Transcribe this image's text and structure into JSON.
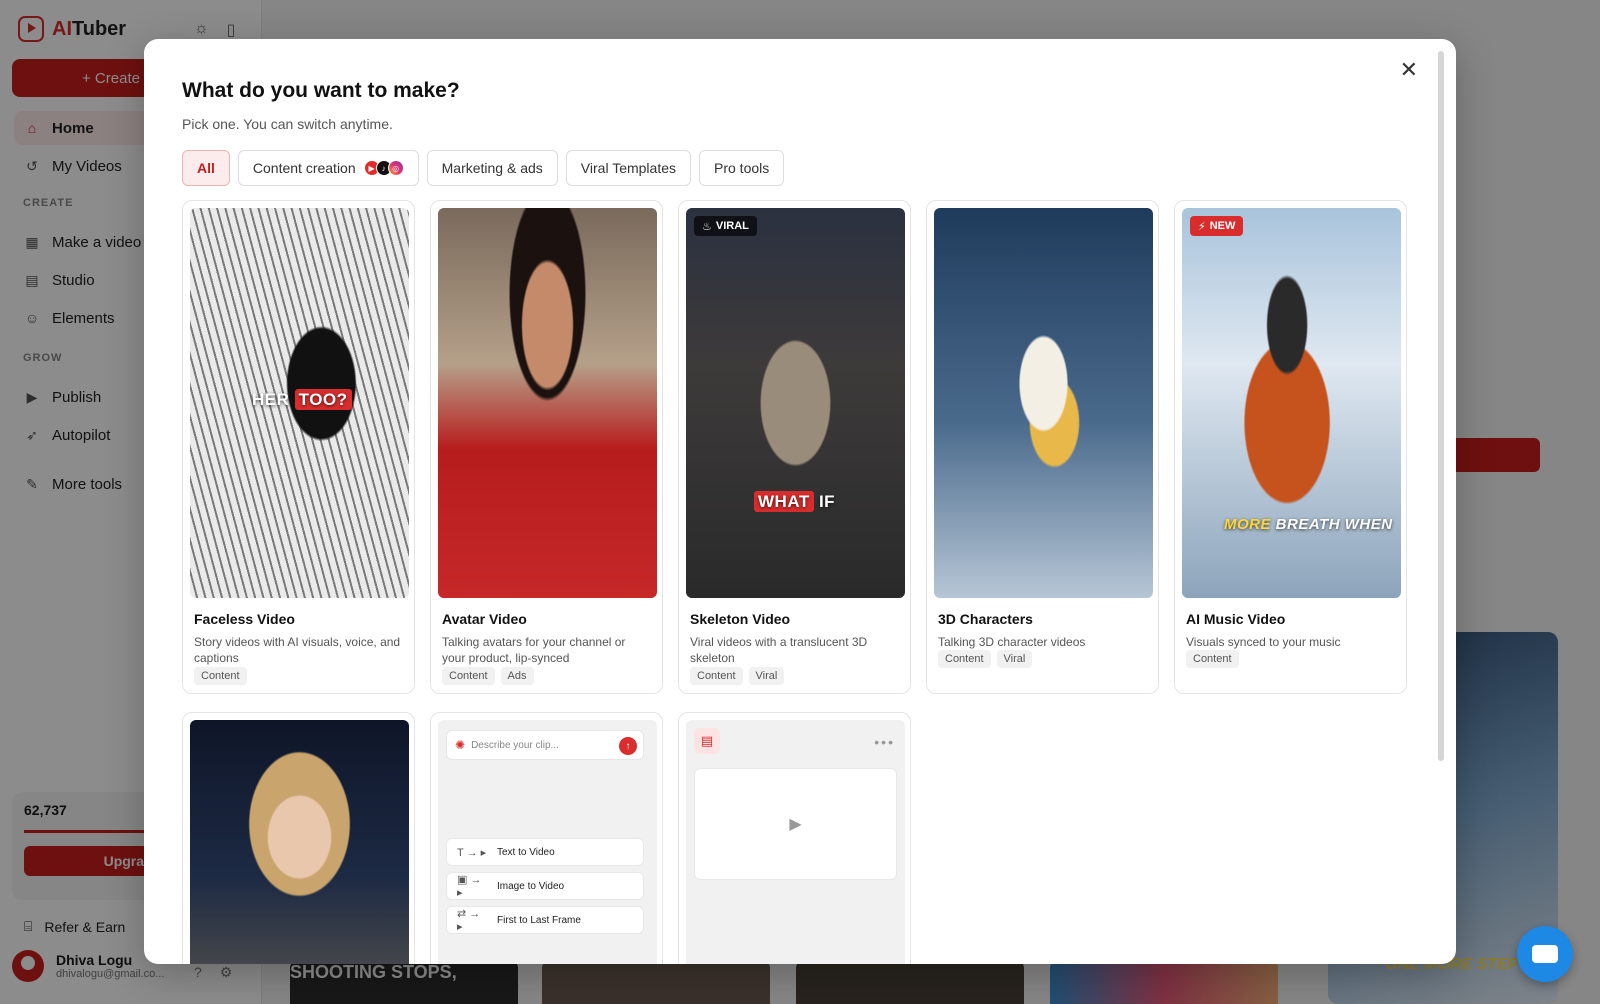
{
  "app": {
    "brand_prefix": "AI",
    "brand_suffix": "Tuber",
    "create_label": "+ Create",
    "nav": {
      "home": "Home",
      "my_videos": "My Videos",
      "section_create": "CREATE",
      "make_video": "Make a video",
      "studio": "Studio",
      "elements": "Elements",
      "section_grow": "GROW",
      "publish": "Publish",
      "autopilot": "Autopilot",
      "more_tools": "More tools"
    },
    "credits": "62,737",
    "upgrade_label": "Upgrade",
    "refer_label": "Refer & Earn",
    "user_name": "Dhiva Logu",
    "user_email": "dhivalogu@gmail.co...",
    "bg_caption_left": "SHOOTING STOPS,",
    "bg_caption_right": "ONE MORE STEP"
  },
  "modal": {
    "title": "What do you want to make?",
    "subtitle": "Pick one. You can switch anytime.",
    "close_icon": "close-icon",
    "filters": [
      {
        "label": "All",
        "active": true
      },
      {
        "label": "Content creation"
      },
      {
        "label": "Marketing & ads"
      },
      {
        "label": "Viral Templates"
      },
      {
        "label": "Pro tools"
      }
    ],
    "cards": [
      {
        "title": "Faceless Video",
        "desc": "Story videos with AI visuals, voice, and captions",
        "tags": [
          "Content"
        ],
        "caption_a": "HER ",
        "caption_b": "TOO?"
      },
      {
        "title": "Avatar Video",
        "desc": "Talking avatars for your channel or your product, lip-synced",
        "tags": [
          "Content",
          "Ads"
        ]
      },
      {
        "title": "Skeleton Video",
        "desc": "Viral videos with a translucent 3D skeleton",
        "tags": [
          "Content",
          "Viral"
        ],
        "badge": "VIRAL",
        "caption_b": "WHAT",
        "caption_c": " IF"
      },
      {
        "title": "3D Characters",
        "desc": "Talking 3D character videos",
        "tags": [
          "Content",
          "Viral"
        ]
      },
      {
        "title": "AI Music Video",
        "desc": "Visuals synced to your music",
        "tags": [
          "Content"
        ],
        "badge": "NEW",
        "caption_a": "MORE",
        "caption_c": " BREATH WHEN"
      }
    ],
    "clip_card": {
      "placeholder": "Describe your clip...",
      "options": [
        "Text to Video",
        "Image to Video",
        "First to Last Frame"
      ]
    }
  },
  "colors": {
    "brand_red": "#d92d2d",
    "active_bg": "#fdecec"
  }
}
